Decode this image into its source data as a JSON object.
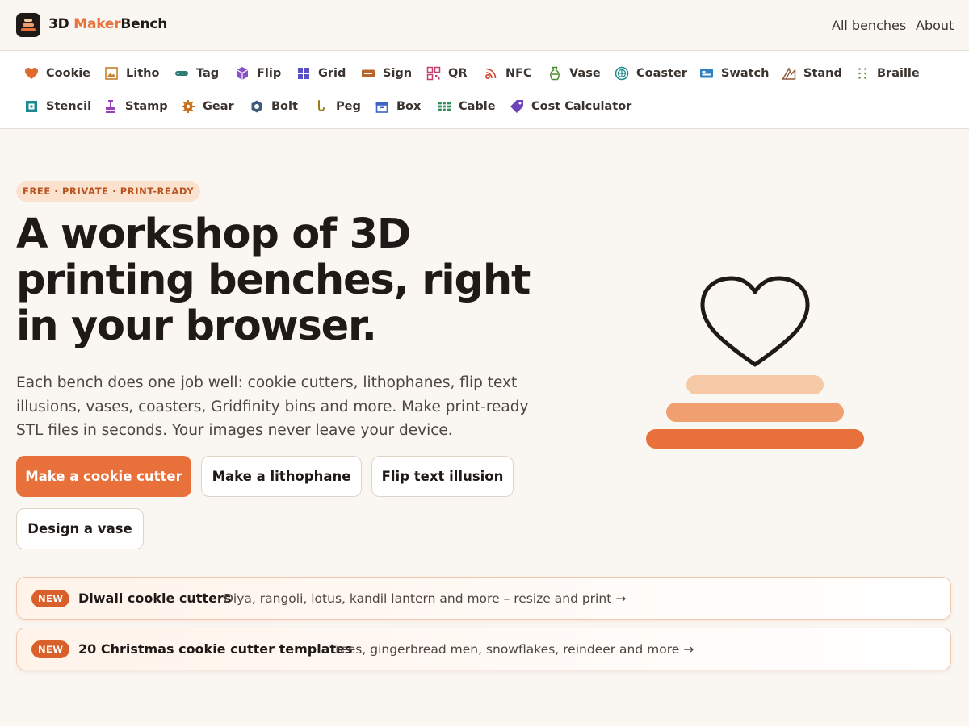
{
  "brand": {
    "prefix": "3D ",
    "accent": "Maker",
    "suffix": "Bench"
  },
  "top_links": [
    "All benches",
    "About"
  ],
  "nav": {
    "row1": [
      {
        "label": "Cookie",
        "icon": "heart-icon"
      },
      {
        "label": "Litho",
        "icon": "image-icon"
      },
      {
        "label": "Tag",
        "icon": "tag-icon"
      },
      {
        "label": "Flip",
        "icon": "cube-icon"
      },
      {
        "label": "Grid",
        "icon": "grid-icon"
      },
      {
        "label": "Sign",
        "icon": "sign-icon"
      },
      {
        "label": "QR",
        "icon": "qr-icon"
      },
      {
        "label": "NFC",
        "icon": "nfc-icon"
      },
      {
        "label": "Vase",
        "icon": "vase-icon"
      },
      {
        "label": "Coaster",
        "icon": "coaster-icon"
      },
      {
        "label": "Swatch",
        "icon": "swatch-icon"
      },
      {
        "label": "Stand",
        "icon": "stand-icon"
      },
      {
        "label": "Braille",
        "icon": "braille-icon"
      }
    ],
    "row2": [
      {
        "label": "Stencil",
        "icon": "stencil-icon"
      },
      {
        "label": "Stamp",
        "icon": "stamp-icon"
      },
      {
        "label": "Gear",
        "icon": "gear-icon"
      },
      {
        "label": "Bolt",
        "icon": "bolt-icon"
      },
      {
        "label": "Peg",
        "icon": "peg-icon"
      },
      {
        "label": "Box",
        "icon": "box-icon"
      },
      {
        "label": "Cable",
        "icon": "cable-icon"
      },
      {
        "label": "Cost Calculator",
        "icon": "price-tag-icon"
      }
    ]
  },
  "hero": {
    "badge": "FREE · PRIVATE · PRINT-READY",
    "headline": "A workshop of 3D printing benches, right in your browser.",
    "subcopy": "Each bench does one job well: cookie cutters, lithophanes, flip text illusions, vases, coasters, Gridfinity bins and more. Make print-ready STL files in seconds. Your images never leave your device.",
    "buttons": [
      "Make a cookie cutter",
      "Make a lithophane",
      "Flip text illusion",
      "Design a vase"
    ]
  },
  "news": [
    {
      "pill": "NEW",
      "title": "Diwali cookie cutters",
      "desc": "Diya, rangoli, lotus, kandil lantern and more – resize and print →"
    },
    {
      "pill": "NEW",
      "title": "20 Christmas cookie cutter templates",
      "desc": "Trees, gingerbread men, snowflakes, reindeer and more →"
    }
  ],
  "colors": {
    "accent": "#e8713b",
    "background": "#faf6f1",
    "badge_bg": "#fbe2cf",
    "badge_text": "#b9531f",
    "ink": "#1f1a17"
  }
}
